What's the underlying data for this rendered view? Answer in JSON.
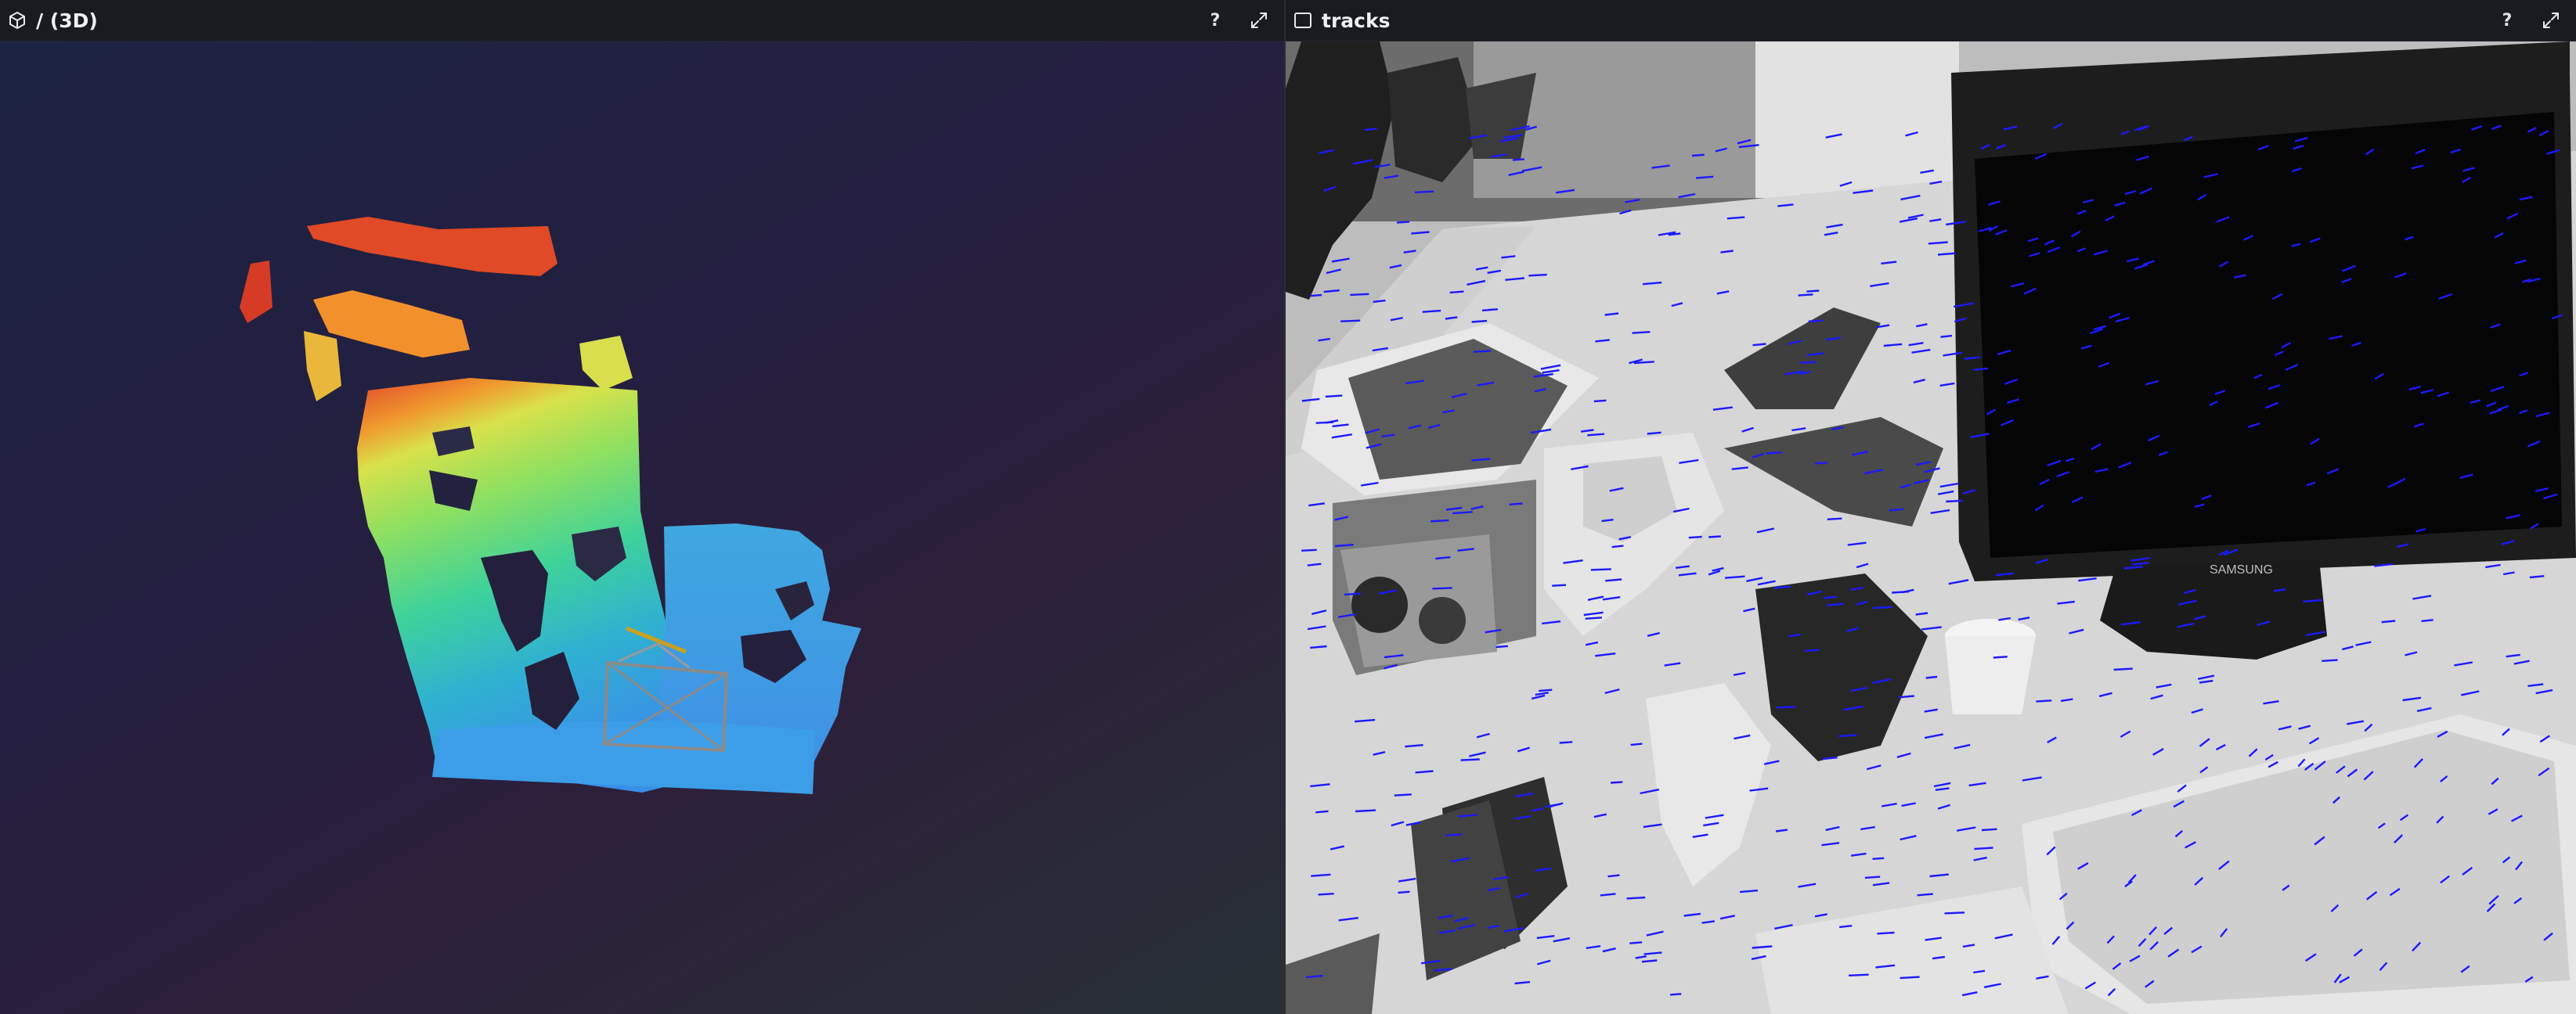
{
  "left_panel": {
    "title": "/ (3D)",
    "help_label": "?",
    "icon": "cube-icon",
    "maximize_icon": "expand-icon"
  },
  "right_panel": {
    "title": "tracks",
    "help_label": "?",
    "icon": "image-view-icon",
    "maximize_icon": "expand-icon",
    "monitor_brand": "SAMSUNG"
  },
  "colors": {
    "header_bg": "#181b20",
    "track_color": "#1a1aff",
    "camera_frustum": "#8a8a8a",
    "camera_up": "#c9a020"
  }
}
